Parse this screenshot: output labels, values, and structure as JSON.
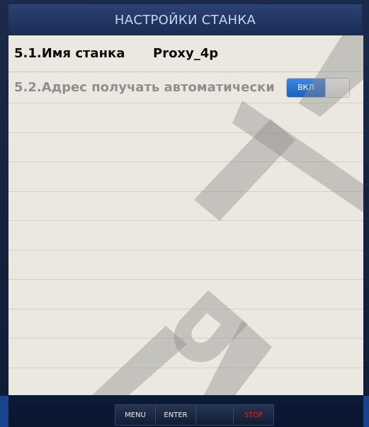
{
  "header": {
    "title": "НАСТРОЙКИ СТАНКА"
  },
  "settings": {
    "machine_name": {
      "label": "5.1.Имя станка",
      "value": "Proxy_4p"
    },
    "auto_address": {
      "label": "5.2.Адрес получать автоматически",
      "toggle_label": "ВКЛ",
      "state": "on"
    }
  },
  "watermark": {
    "text": "RT"
  },
  "footer": {
    "buttons": [
      "MENU",
      "ENTER",
      "",
      "STOP"
    ]
  },
  "colors": {
    "accent": "#1c5fc0",
    "stop": "#d62a2a",
    "panel": "#ebe8e2"
  }
}
